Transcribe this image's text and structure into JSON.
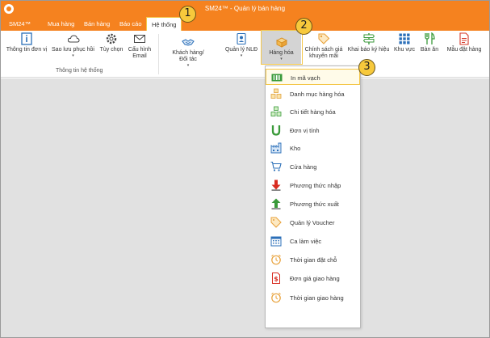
{
  "window": {
    "title": "SM24™ - Quản lý bán hàng"
  },
  "menu": {
    "items": [
      "SM24™",
      "Mua hàng",
      "Bán hàng",
      "Báo cáo",
      "Hệ thống"
    ],
    "active": "Hệ thống"
  },
  "ribbon": {
    "group1": {
      "label": "Thông tin hệ thống",
      "buttons": [
        {
          "label": "Thông tin đơn vị",
          "icon": "info-icon"
        },
        {
          "label": "Sao lưu phục hồi",
          "icon": "cloud-icon",
          "has_dropdown": true
        },
        {
          "label": "Tùy chọn",
          "icon": "gear-icon"
        },
        {
          "label": "Cấu hình",
          "label2": "Email",
          "icon": "email-icon"
        }
      ]
    },
    "buttons": [
      {
        "label": "Khách hàng/",
        "label2": "Đối tác",
        "icon": "handshake-icon",
        "has_dropdown": true
      },
      {
        "label": "Quản lý NLĐ",
        "icon": "employee-icon",
        "has_dropdown": true
      },
      {
        "label": "Hàng hóa",
        "icon": "goods-icon",
        "has_dropdown": true,
        "pressed": true
      },
      {
        "label": "Chính sách giá",
        "label2": "khuyến mãi",
        "icon": "price-tag-icon"
      },
      {
        "label": "Khai báo ký hiệu",
        "icon": "signpost-icon"
      },
      {
        "label": "Khu vực",
        "icon": "grid-icon"
      },
      {
        "label": "Bàn ăn",
        "icon": "dining-icon"
      },
      {
        "label": "Mẫu đặt hàng",
        "icon": "order-form-icon"
      }
    ],
    "dropdown_arrow": "▾"
  },
  "dropdown": {
    "items": [
      {
        "label": "In mã vạch",
        "icon": "barcode-icon",
        "highlighted": true
      },
      {
        "label": "Danh mục hàng hóa",
        "icon": "boxes-stack-icon"
      },
      {
        "label": "Chi tiết hàng hóa",
        "icon": "green-boxes-icon"
      },
      {
        "label": "Đơn vị tính",
        "icon": "magnet-icon"
      },
      {
        "label": "Kho",
        "icon": "warehouse-icon"
      },
      {
        "label": "Cửa hàng",
        "icon": "cart-icon"
      },
      {
        "label": "Phương thức nhập",
        "icon": "arrow-down-icon"
      },
      {
        "label": "Phương thức xuất",
        "icon": "arrow-up-icon"
      },
      {
        "label": "Quản lý Voucher",
        "icon": "voucher-tag-icon"
      },
      {
        "label": "Ca làm việc",
        "icon": "calendar-icon"
      },
      {
        "label": "Thời gian đặt chỗ",
        "icon": "alarm-clock-icon"
      },
      {
        "label": "Đơn giá giao hàng",
        "icon": "dollar-doc-icon"
      },
      {
        "label": "Thời gian giao hàng",
        "icon": "delivery-clock-icon"
      }
    ]
  },
  "markers": [
    "1",
    "2",
    "3"
  ],
  "colors": {
    "accent": "#f5821f",
    "highlight": "#f4c74a",
    "background": "#e1e1e1"
  }
}
